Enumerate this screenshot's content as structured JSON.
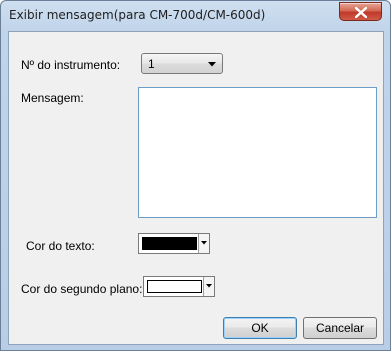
{
  "window": {
    "title": "Exibir mensagem(para CM-700d/CM-600d)"
  },
  "form": {
    "instrument_label": "Nº do instrumento:",
    "instrument_value": "1",
    "message_label": "Mensagem:",
    "message_value": "",
    "text_color_label": "Cor do texto:",
    "text_color": "#000000",
    "background_color_label": "Cor do segundo plano:",
    "background_color": "#ffffff"
  },
  "buttons": {
    "ok": "OK",
    "cancel": "Cancelar"
  },
  "icons": {
    "close": "close-icon",
    "dropdown": "chevron-down-icon"
  }
}
